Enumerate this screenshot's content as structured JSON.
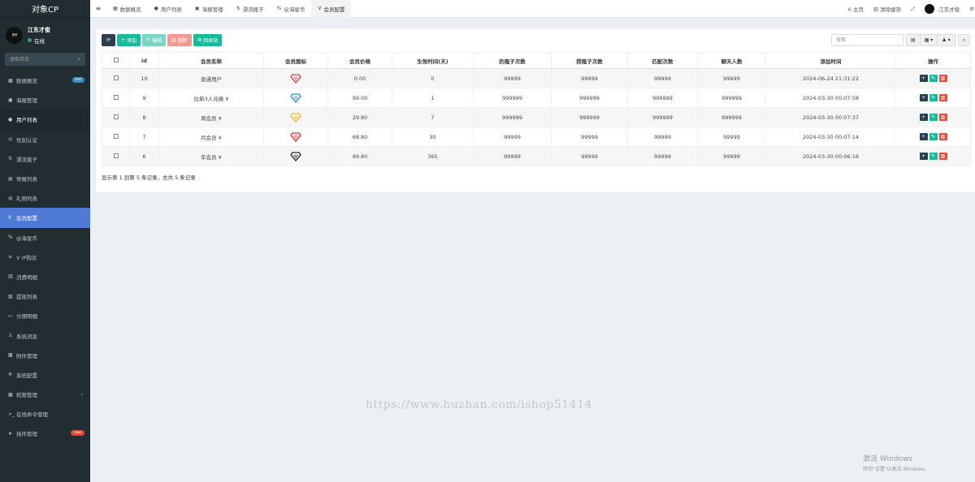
{
  "sidebar": {
    "logo": "对象CP",
    "user_name": "江东才俊",
    "user_status": "在线",
    "avatar_text": "推荐",
    "search_placeholder": "搜索菜单",
    "items": [
      {
        "label": "数据概览",
        "icon": "dashboard-icon",
        "glyph": "▦",
        "badge": "hot"
      },
      {
        "label": "海报管理",
        "icon": "poster-icon",
        "glyph": "▣"
      },
      {
        "label": "用户列表",
        "icon": "user-icon",
        "glyph": "●"
      },
      {
        "label": "性别认证",
        "icon": "gender-icon",
        "glyph": "◎"
      },
      {
        "label": "漂流瓶子",
        "icon": "bottle-icon",
        "glyph": "⇅"
      },
      {
        "label": "举报列表",
        "icon": "report-icon",
        "glyph": "▤"
      },
      {
        "label": "礼物列表",
        "icon": "gift-icon",
        "glyph": "◍"
      },
      {
        "label": "会员配置",
        "icon": "vip-icon",
        "glyph": "V"
      },
      {
        "label": "@海星币",
        "icon": "coin-icon",
        "glyph": "%"
      },
      {
        "label": "V IP购买",
        "icon": "purchase-icon",
        "glyph": "≡"
      },
      {
        "label": "消费明细",
        "icon": "consume-icon",
        "glyph": "▥"
      },
      {
        "label": "提现列表",
        "icon": "withdraw-icon",
        "glyph": "▧"
      },
      {
        "label": "分佣明细",
        "icon": "commission-icon",
        "glyph": "▭"
      },
      {
        "label": "系统消息",
        "icon": "message-icon",
        "glyph": "♙"
      },
      {
        "label": "附件管理",
        "icon": "attachment-icon",
        "glyph": "▩"
      },
      {
        "label": "系统配置",
        "icon": "gear-icon",
        "glyph": "✲"
      },
      {
        "label": "权限管理",
        "icon": "permission-icon",
        "glyph": "▦"
      },
      {
        "label": "在线命令管理",
        "icon": "terminal-icon",
        "glyph": ">_"
      },
      {
        "label": "插件管理",
        "icon": "plugin-icon",
        "glyph": "➤",
        "badge": "new"
      }
    ]
  },
  "topbar": {
    "tabs": [
      {
        "label": "数据概览",
        "icon": "dashboard-icon",
        "glyph": "▦"
      },
      {
        "label": "用户列表",
        "icon": "user-icon",
        "glyph": "●"
      },
      {
        "label": "海报管理",
        "icon": "poster-icon",
        "glyph": "▣"
      },
      {
        "label": "漂流瓶子",
        "icon": "bottle-icon",
        "glyph": "⇅"
      },
      {
        "label": "@海星币",
        "icon": "coin-icon",
        "glyph": "%"
      },
      {
        "label": "会员配置",
        "icon": "vip-icon",
        "glyph": "V"
      }
    ],
    "home": "主页",
    "clear_cache": "清除缓存",
    "user_name": "江东才俊"
  },
  "toolbar": {
    "add": "添加",
    "edit": "编辑",
    "delete": "删除",
    "recycle": "回收站",
    "search_placeholder": "搜索"
  },
  "table": {
    "columns": [
      "id",
      "会员名称",
      "会员图标",
      "会员价格",
      "生效时间(天)",
      "扔瓶子次数",
      "捞瓶子次数",
      "匹配次数",
      "聊天人数",
      "添加时间",
      "操作"
    ],
    "rows": [
      {
        "id": "10",
        "name": "普通用户",
        "icon_color": "#d94040",
        "price": "0.00",
        "days": "0",
        "throw": "99999",
        "pick": "99999",
        "match": "99999",
        "chat": "99999",
        "time": "2024-06-24 21:31:22"
      },
      {
        "id": "9",
        "name": "拉新3人兑换 ¥",
        "icon_color": "#2d8bd7",
        "price": "99.00",
        "days": "1",
        "throw": "999999",
        "pick": "999999",
        "match": "999999",
        "chat": "999999",
        "time": "2024-03-30 00:07:58"
      },
      {
        "id": "8",
        "name": "周会员 ¥",
        "icon_color": "#f0b020",
        "price": "29.80",
        "days": "7",
        "throw": "999999",
        "pick": "999999",
        "match": "999999",
        "chat": "999999",
        "time": "2024-03-30 00:07:37"
      },
      {
        "id": "7",
        "name": "月会员 ¥",
        "icon_color": "#d62f2f",
        "price": "68.80",
        "days": "30",
        "throw": "99999",
        "pick": "99999",
        "match": "99999",
        "chat": "99999",
        "time": "2024-03-30 00:07:14"
      },
      {
        "id": "6",
        "name": "年会员 ¥",
        "icon_color": "#222222",
        "price": "99.80",
        "days": "365",
        "throw": "99999",
        "pick": "99999",
        "match": "99999",
        "chat": "99999",
        "time": "2024-03-30 00:06:16"
      }
    ]
  },
  "pager_info": "显示第 1 到第 5 条记录，总共 5 条记录",
  "watermark": "https://www.huzhan.com/ishop51414",
  "windows_activate": {
    "title": "激活 Windows",
    "subtitle": "转到\"设置\"以激活 Windows。"
  }
}
